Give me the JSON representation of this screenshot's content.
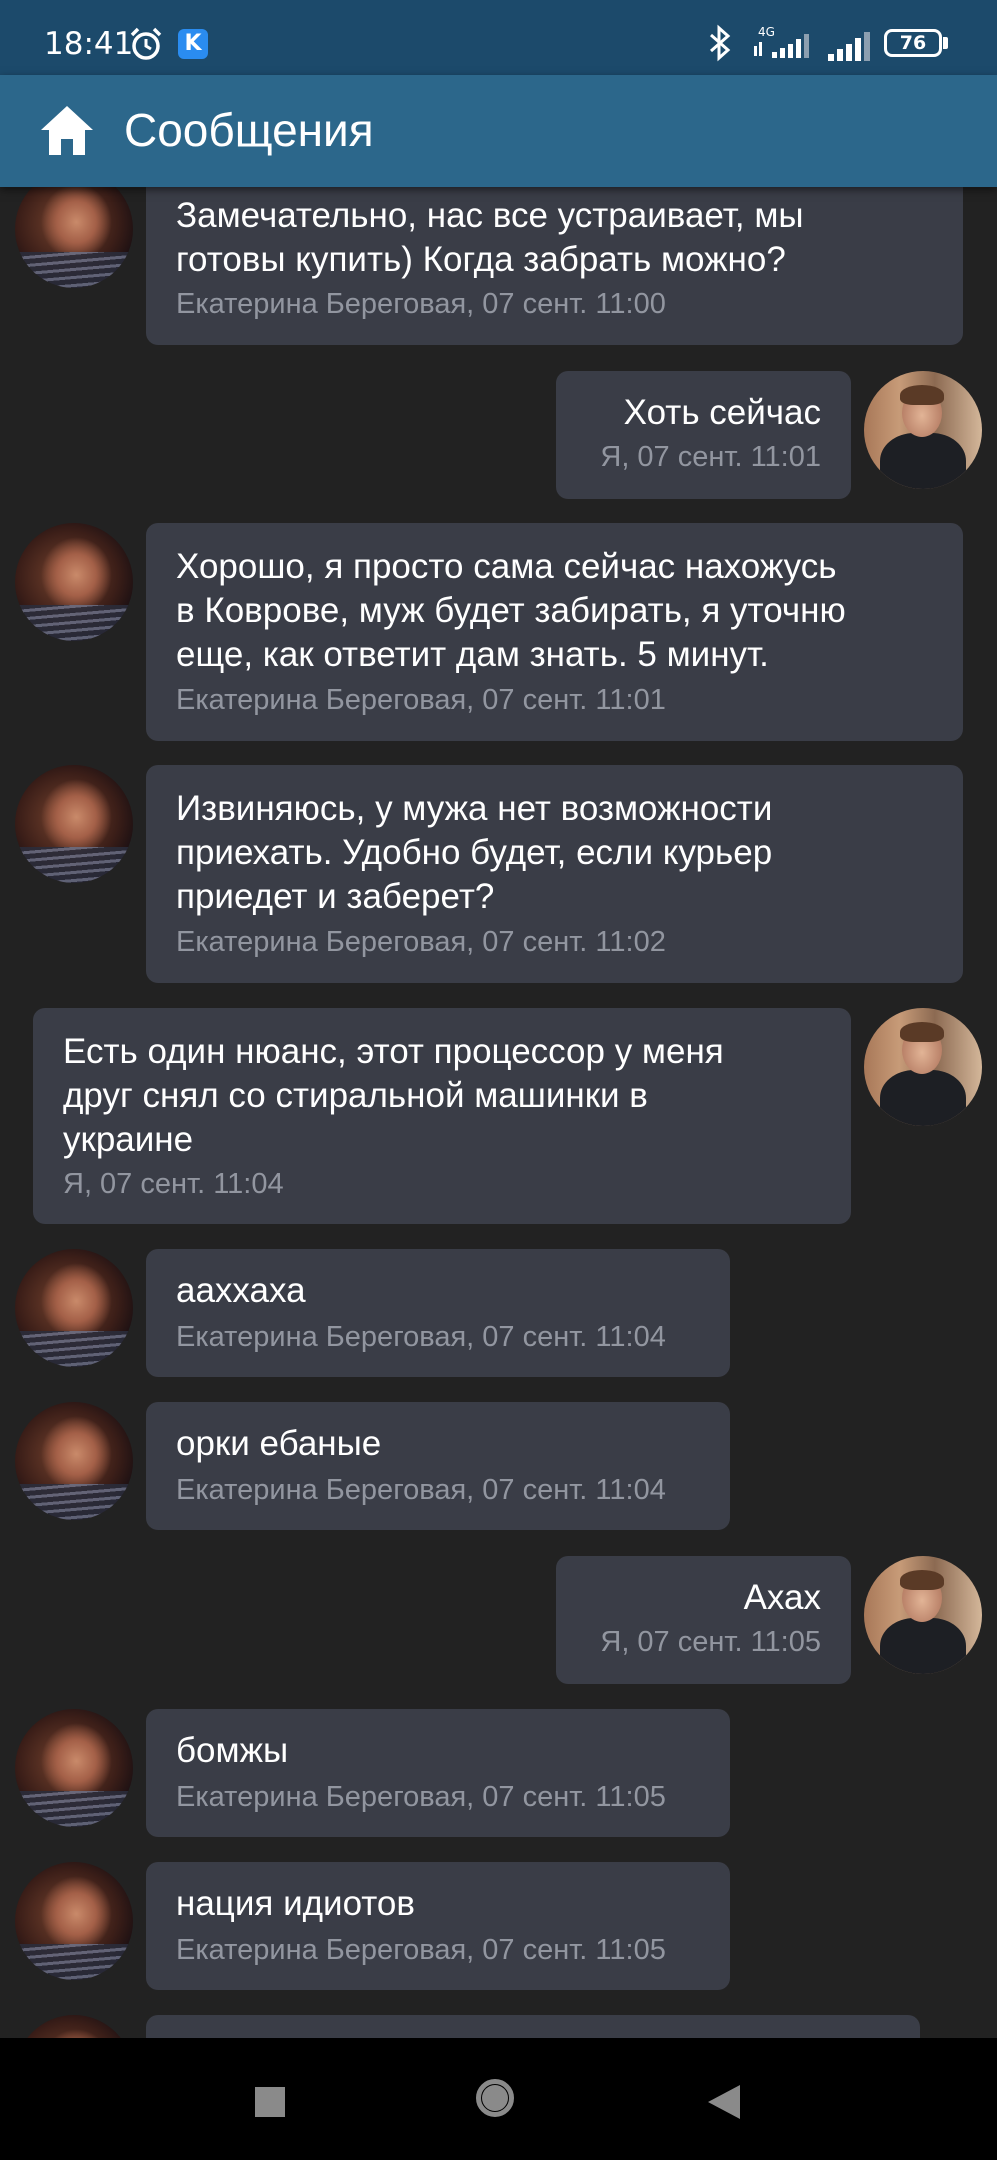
{
  "status_bar": {
    "time": "18:41",
    "k_badge": "K",
    "network": "4G",
    "battery": "76"
  },
  "header": {
    "title": "Сообщения",
    "home_icon": "home-icon"
  },
  "messages": [
    {
      "text": "Замечательно, нас все устраивает, мы\nготовы купить) Когда забрать можно?",
      "meta": "Екатерина Береговая, 07 сент. 11:00",
      "from": "her"
    },
    {
      "text": "Хоть сейчас",
      "meta": "Я, 07 сент. 11:01",
      "from": "me"
    },
    {
      "text": "Хорошо, я просто сама сейчас нахожусь\nв Коврове, муж будет забирать, я уточню\nеще, как ответит дам знать. 5 минут.",
      "meta": "Екатерина Береговая, 07 сент. 11:01",
      "from": "her"
    },
    {
      "text": "Извиняюсь, у мужа нет возможности\nприехать. Удобно будет, если курьер\nприедет и заберет?",
      "meta": "Екатерина Береговая, 07 сент. 11:02",
      "from": "her"
    },
    {
      "text": "Есть один нюанс, этот процессор у меня\nдруг снял со стиральной машинки в\nукраине",
      "meta": "Я, 07 сент. 11:04",
      "from": "me"
    },
    {
      "text": "ааххаха",
      "meta": "Екатерина Береговая, 07 сент. 11:04",
      "from": "her"
    },
    {
      "text": "орки ебаные",
      "meta": "Екатерина Береговая, 07 сент. 11:04",
      "from": "her"
    },
    {
      "text": "Ахах",
      "meta": "Я, 07 сент. 11:05",
      "from": "me"
    },
    {
      "text": "бомжы",
      "meta": "Екатерина Береговая, 07 сент. 11:05",
      "from": "her"
    },
    {
      "text": "нация идиотов",
      "meta": "Екатерина Береговая, 07 сент. 11:05",
      "from": "her"
    }
  ],
  "nav": {
    "recents_icon": "square-icon",
    "home_icon": "circle-home-icon",
    "back_icon": "back-triangle-icon"
  },
  "colors": {
    "status_bar": "#1c4a6b",
    "app_bar": "#2c678b",
    "background": "#222222",
    "bubble": "#3a3d47",
    "meta_text": "#9296a0"
  }
}
